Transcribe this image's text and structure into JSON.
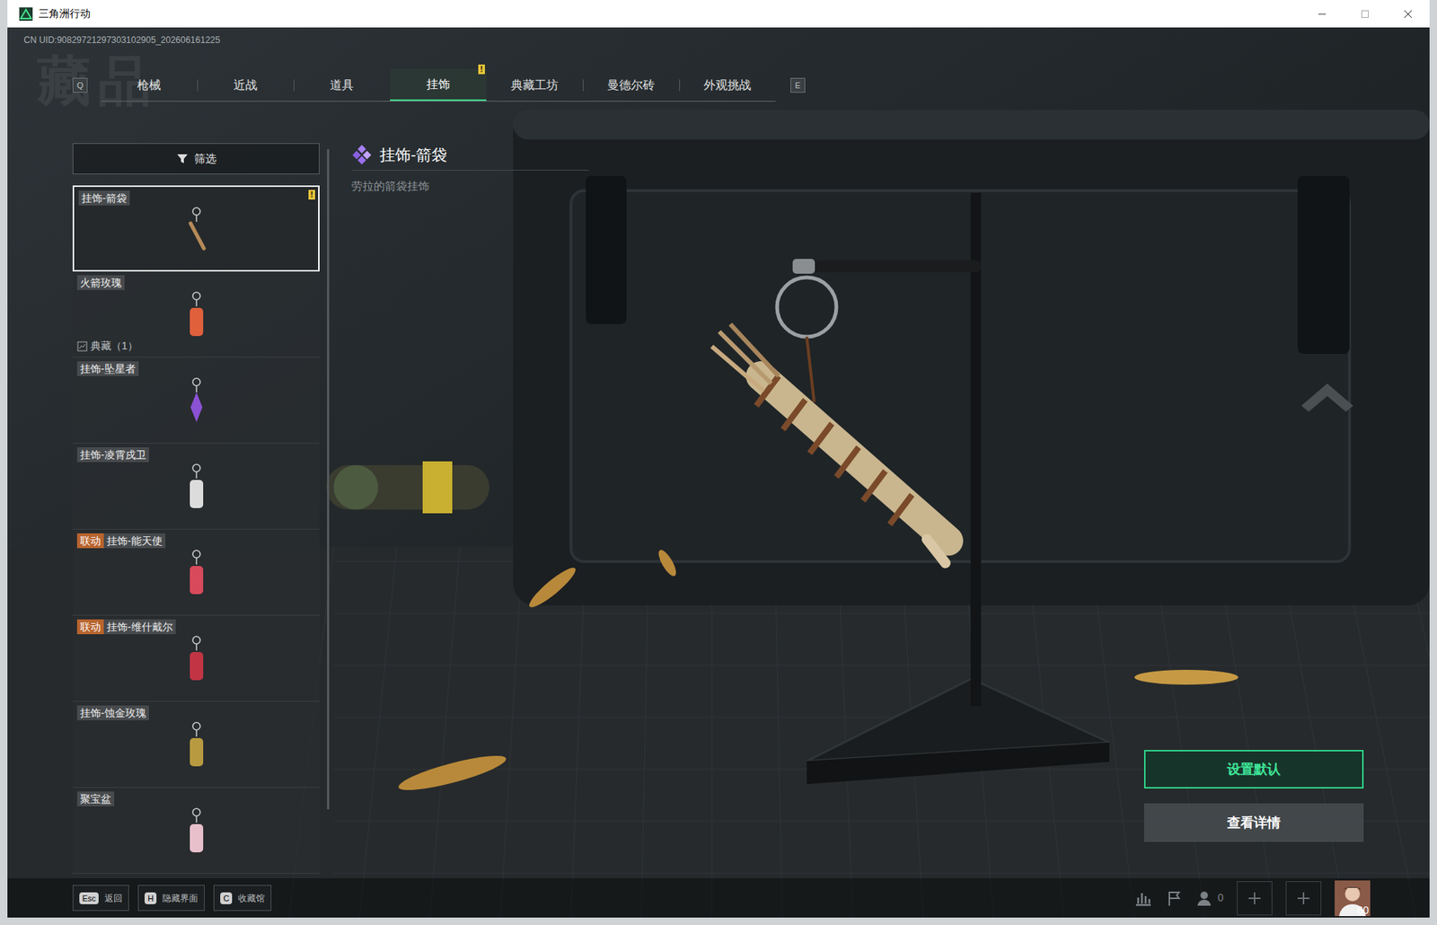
{
  "window": {
    "title": "三角洲行动"
  },
  "uid": "CN UID:90829721297303102905_202606161225",
  "watermark": "藏品",
  "tabs": {
    "prev_key": "Q",
    "next_key": "E",
    "items": [
      {
        "label": "枪械",
        "selected": false,
        "badge": ""
      },
      {
        "label": "近战",
        "selected": false,
        "badge": ""
      },
      {
        "label": "道具",
        "selected": false,
        "badge": ""
      },
      {
        "label": "挂饰",
        "selected": true,
        "badge": "!"
      },
      {
        "label": "典藏工坊",
        "selected": false,
        "badge": ""
      },
      {
        "label": "曼德尔砖",
        "selected": false,
        "badge": ""
      },
      {
        "label": "外观挑战",
        "selected": false,
        "badge": ""
      }
    ]
  },
  "filter": {
    "label": "筛选"
  },
  "items": [
    {
      "name": "挂饰-箭袋",
      "tag": "",
      "selected": true,
      "badge": "!",
      "collection": ""
    },
    {
      "name": "火箭玫瑰",
      "tag": "",
      "selected": false,
      "badge": "",
      "collection": "典藏（1）"
    },
    {
      "name": "挂饰-坠星者",
      "tag": "",
      "selected": false,
      "badge": "",
      "collection": ""
    },
    {
      "name": "挂饰-凌霄戍卫",
      "tag": "",
      "selected": false,
      "badge": "",
      "collection": ""
    },
    {
      "name": "挂饰-能天使",
      "tag": "联动",
      "selected": false,
      "badge": "",
      "collection": ""
    },
    {
      "name": "挂饰-维什戴尔",
      "tag": "联动",
      "selected": false,
      "badge": "",
      "collection": ""
    },
    {
      "name": "挂饰-蚀金玫瑰",
      "tag": "",
      "selected": false,
      "badge": "",
      "collection": ""
    },
    {
      "name": "聚宝盆",
      "tag": "",
      "selected": false,
      "badge": "",
      "collection": ""
    }
  ],
  "detail": {
    "title": "挂饰-箭袋",
    "description": "劳拉的箭袋挂饰"
  },
  "actions": [
    {
      "label": "设置默认",
      "primary": true
    },
    {
      "label": "查看详情",
      "primary": false
    }
  ],
  "hints": [
    {
      "key": "Esc",
      "label": "返回"
    },
    {
      "key": "H",
      "label": "隐藏界面"
    },
    {
      "key": "C",
      "label": "收藏馆"
    }
  ],
  "status": {
    "friends": "0",
    "level": "60"
  }
}
